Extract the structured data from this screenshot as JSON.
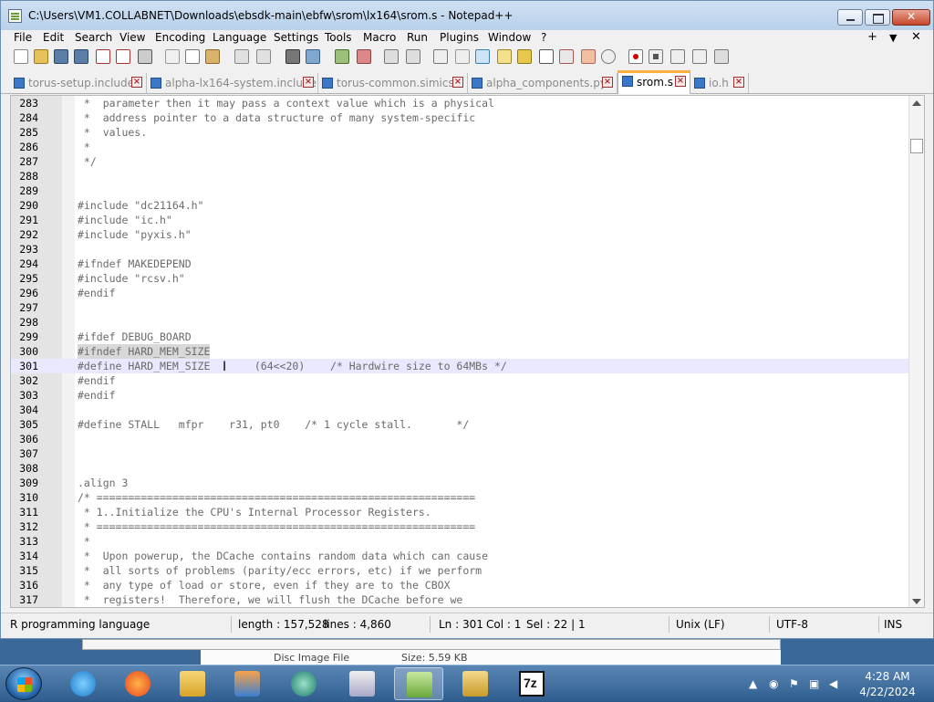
{
  "window": {
    "title": "C:\\Users\\VM1.COLLABNET\\Downloads\\ebsdk-main\\ebfw\\srom\\lx164\\srom.s - Notepad++"
  },
  "menu": {
    "items": [
      "File",
      "Edit",
      "Search",
      "View",
      "Encoding",
      "Language",
      "Settings",
      "Tools",
      "Macro",
      "Run",
      "Plugins",
      "Window",
      "?"
    ],
    "right": [
      "+",
      "▼",
      "✕"
    ]
  },
  "tabs": [
    {
      "label": "torus-setup.include",
      "active": false
    },
    {
      "label": "alpha-lx164-system.include",
      "active": false
    },
    {
      "label": "torus-common.simics",
      "active": false
    },
    {
      "label": "alpha_components.py",
      "active": false
    },
    {
      "label": "srom.s",
      "active": true
    },
    {
      "label": "io.h",
      "active": false
    }
  ],
  "editor": {
    "current_line": 301,
    "lines": [
      {
        "n": "283",
        "text": " *  parameter then it may pass a context value which is a physical"
      },
      {
        "n": "284",
        "text": " *  address pointer to a data structure of many system-specific"
      },
      {
        "n": "285",
        "text": " *  values."
      },
      {
        "n": "286",
        "text": " *"
      },
      {
        "n": "287",
        "text": " */"
      },
      {
        "n": "288",
        "text": ""
      },
      {
        "n": "289",
        "text": ""
      },
      {
        "n": "290",
        "text": "#include \"dc21164.h\""
      },
      {
        "n": "291",
        "text": "#include \"ic.h\""
      },
      {
        "n": "292",
        "text": "#include \"pyxis.h\""
      },
      {
        "n": "293",
        "text": ""
      },
      {
        "n": "294",
        "text": "#ifndef MAKEDEPEND"
      },
      {
        "n": "295",
        "text": "#include \"rcsv.h\""
      },
      {
        "n": "296",
        "text": "#endif"
      },
      {
        "n": "297",
        "text": ""
      },
      {
        "n": "298",
        "text": ""
      },
      {
        "n": "299",
        "text": "#ifdef DEBUG_BOARD"
      },
      {
        "n": "300",
        "text": "#ifndef HARD_MEM_SIZE"
      },
      {
        "n": "301",
        "text": "#define HARD_MEM_SIZE       (64<<20)    /* Hardwire size to 64MBs */"
      },
      {
        "n": "302",
        "text": "#endif"
      },
      {
        "n": "303",
        "text": "#endif"
      },
      {
        "n": "304",
        "text": ""
      },
      {
        "n": "305",
        "text": "#define STALL   mfpr    r31, pt0    /* 1 cycle stall.       */"
      },
      {
        "n": "306",
        "text": ""
      },
      {
        "n": "307",
        "text": ""
      },
      {
        "n": "308",
        "text": ""
      },
      {
        "n": "309",
        "text": ".align 3"
      },
      {
        "n": "310",
        "text": "/* ============================================================"
      },
      {
        "n": "311",
        "text": " * 1..Initialize the CPU's Internal Processor Registers."
      },
      {
        "n": "312",
        "text": " * ============================================================"
      },
      {
        "n": "313",
        "text": " *"
      },
      {
        "n": "314",
        "text": " *  Upon powerup, the DCache contains random data which can cause"
      },
      {
        "n": "315",
        "text": " *  all sorts of problems (parity/ecc errors, etc) if we perform"
      },
      {
        "n": "316",
        "text": " *  any type of load or store, even if they are to the CBOX"
      },
      {
        "n": "317",
        "text": " *  registers!  Therefore, we will flush the DCache before we"
      }
    ]
  },
  "status": {
    "language": "R programming language",
    "length": "length : 157,528",
    "lines": "lines : 4,860",
    "ln": "Ln : 301",
    "col": "Col : 1",
    "sel": "Sel : 22 | 1",
    "eol": "Unix (LF)",
    "encoding": "UTF-8",
    "mode": "INS"
  },
  "behind_window": {
    "label1": "Disc Image File",
    "label2": "Size: 5.59 KB"
  },
  "taskbar": {
    "time": "4:28 AM",
    "date": "4/22/2024"
  },
  "colors": {
    "active_tab_accent": "#fab03c",
    "current_line_bg": "#e8e8ff",
    "code_text": "#6a6a6a"
  }
}
